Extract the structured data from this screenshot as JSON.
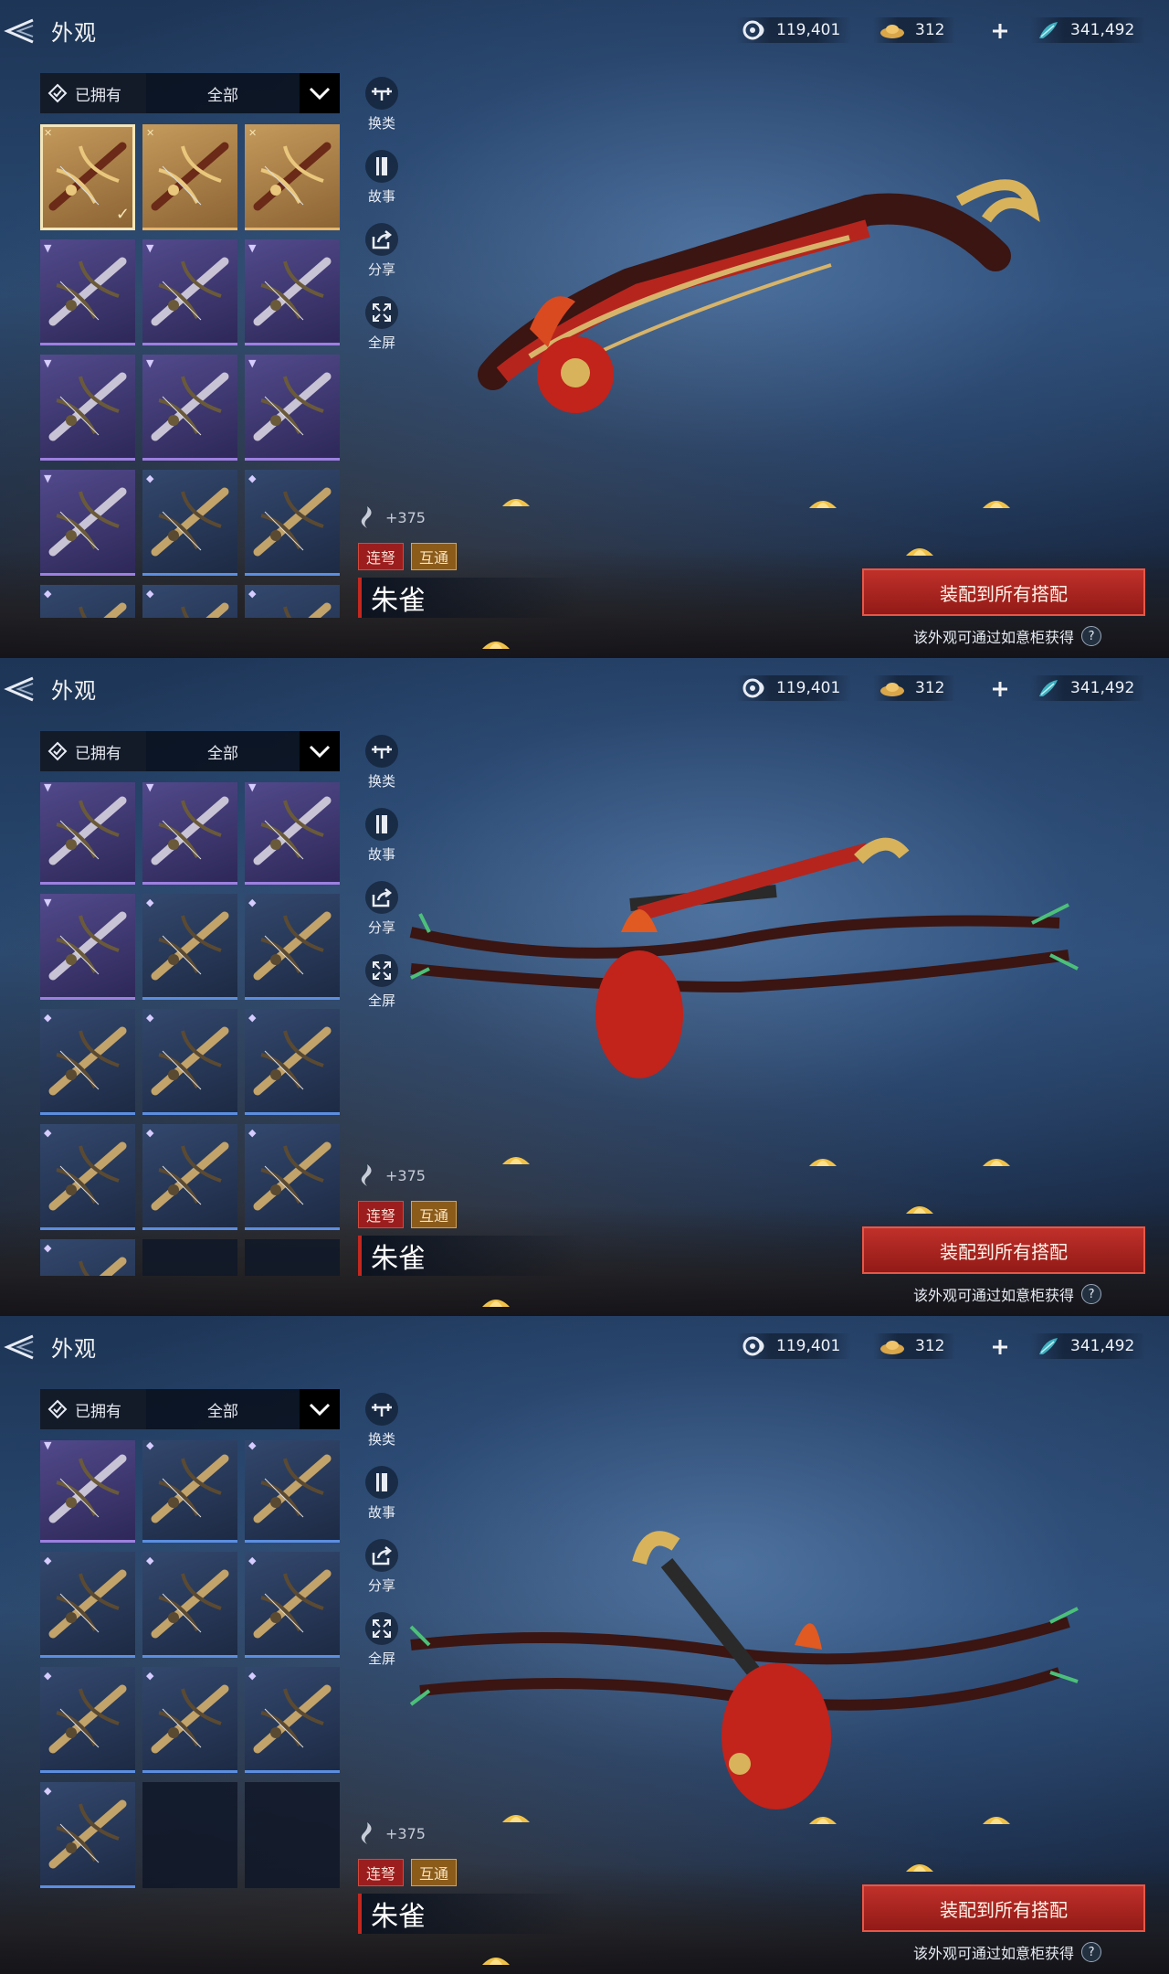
{
  "page": {
    "title": "外观",
    "currencies": [
      {
        "icon": "spiral-token-icon",
        "value": "119,401"
      },
      {
        "icon": "gold-ingot-icon",
        "value": "312"
      },
      {
        "icon": "jade-feather-icon",
        "value": "341,492"
      }
    ],
    "add_icon": "plus-icon"
  },
  "filter": {
    "owned_label": "已拥有",
    "all_label": "全部"
  },
  "tools": [
    {
      "label": "换类",
      "icon": "crossbow-switch-icon"
    },
    {
      "label": "故事",
      "icon": "book-icon"
    },
    {
      "label": "分享",
      "icon": "share-icon"
    },
    {
      "label": "全屏",
      "icon": "fullscreen-icon"
    }
  ],
  "item": {
    "power": "+375",
    "tags": [
      "连弩",
      "互通"
    ],
    "name": "朱雀",
    "equip_label": "装配到所有搭配",
    "source_text": "该外观可通过如意柜获得",
    "help": "?"
  },
  "colors": {
    "gold": "#c59a5c",
    "purple": "#524a8c",
    "blue": "#33486e",
    "accent_red": "#c0302a"
  },
  "weapon_rarity_grid": {
    "rows": [
      [
        "gold",
        "gold",
        "gold"
      ],
      [
        "purple",
        "purple",
        "purple"
      ],
      [
        "purple",
        "purple",
        "purple"
      ],
      [
        "purple",
        "blue",
        "blue"
      ],
      [
        "blue",
        "blue",
        "blue"
      ],
      [
        "blue",
        "blue",
        "blue"
      ],
      [
        "blue",
        "empty",
        "empty"
      ]
    ],
    "selected_index": 0
  }
}
